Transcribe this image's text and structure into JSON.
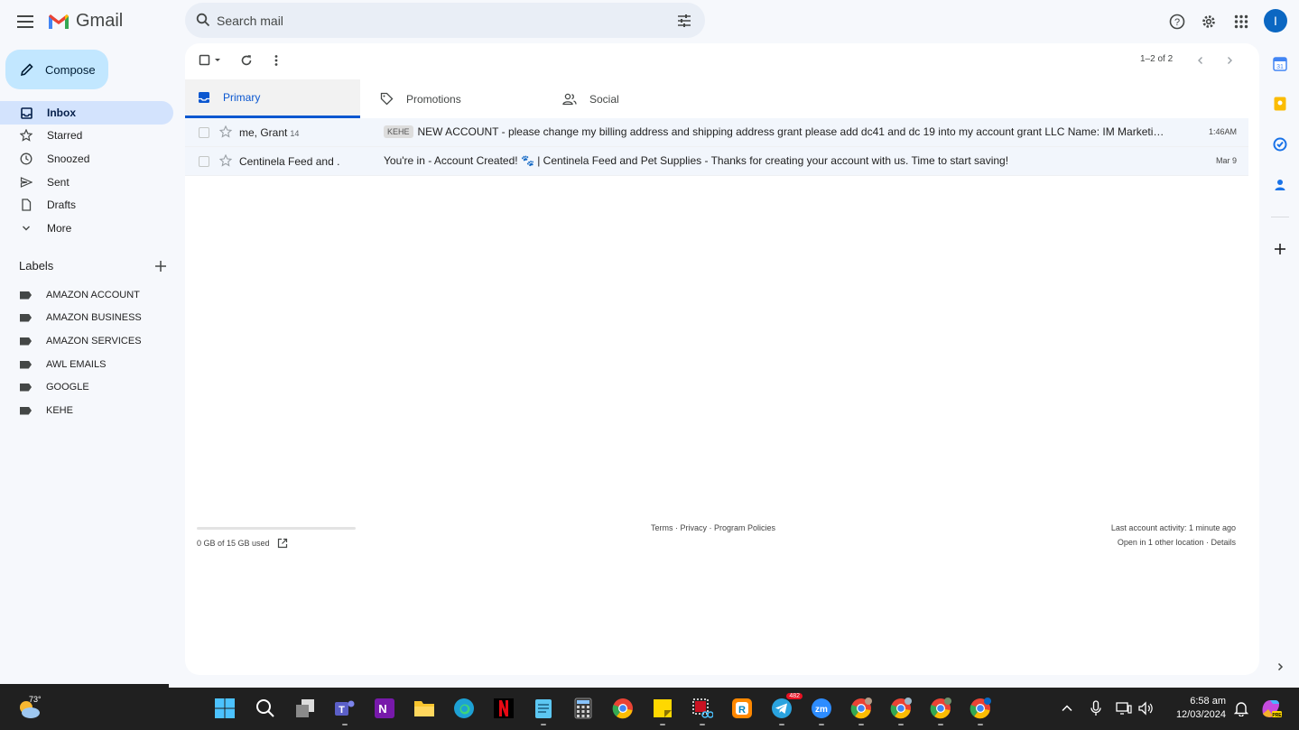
{
  "app": {
    "name": "Gmail"
  },
  "search": {
    "placeholder": "Search mail"
  },
  "compose": {
    "label": "Compose"
  },
  "nav": [
    {
      "label": "Inbox",
      "active": true
    },
    {
      "label": "Starred"
    },
    {
      "label": "Snoozed"
    },
    {
      "label": "Sent"
    },
    {
      "label": "Drafts"
    },
    {
      "label": "More"
    }
  ],
  "labels": {
    "title": "Labels",
    "items": [
      "AMAZON ACCOUNT",
      "AMAZON BUSINESS",
      "AMAZON SERVICES",
      "AWL EMAILS",
      "GOOGLE",
      "KEHE"
    ]
  },
  "user": {
    "initial": "I"
  },
  "toolbar": {
    "pager": "1–2 of 2"
  },
  "tabs": [
    {
      "label": "Primary",
      "active": true
    },
    {
      "label": "Promotions"
    },
    {
      "label": "Social"
    }
  ],
  "emails": [
    {
      "sender": "me, Grant",
      "count": "14",
      "tag": "KEHE",
      "subject": "NEW ACCOUNT - please change my billing address and shipping address grant please add dc41 and dc 19 into my account grant LLC Name: IM Marketing LLC Billi...",
      "date": "1:46AM"
    },
    {
      "sender": "Centinela Feed and .",
      "count": "",
      "tag": "",
      "subject": "You're in - Account Created! 🐾 | Centinela Feed and Pet Supplies - Thanks for creating your account with us. Time to start saving!",
      "date": "Mar 9"
    }
  ],
  "footer": {
    "storage": "0 GB of 15 GB used",
    "terms": "Terms",
    "privacy": "Privacy",
    "policies": "Program Policies",
    "sep": " · ",
    "activity": "Last account activity: 1 minute ago",
    "other_location": "Open in 1 other location",
    "details": "Details"
  },
  "taskbar": {
    "temperature": "73°",
    "telegram_badge": "482",
    "time": "6:58 am",
    "date": "12/03/2024"
  },
  "colors": {
    "accent": "#0b57d0",
    "compose": "#c2e7ff",
    "active_nav": "#d3e3fd"
  }
}
